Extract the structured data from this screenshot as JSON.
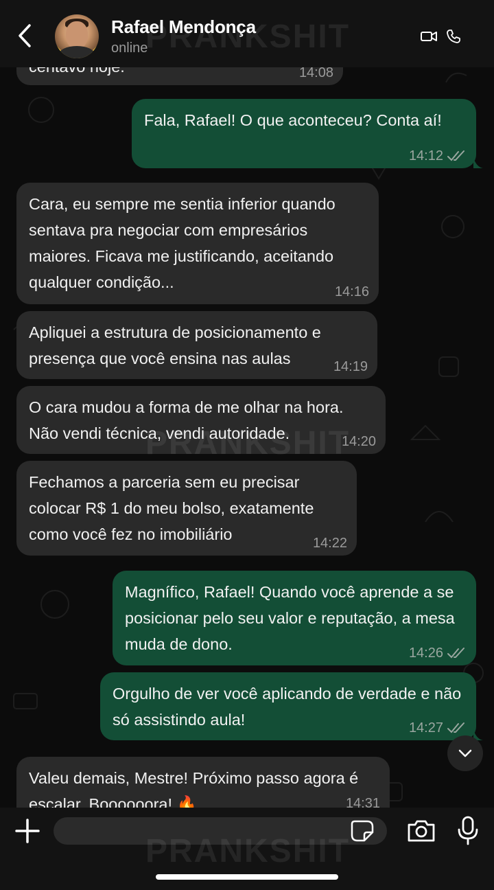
{
  "header": {
    "contact_name": "Rafael Mendonça",
    "status": "online",
    "icons": [
      "back-arrow-icon",
      "video-call-icon",
      "phone-icon"
    ]
  },
  "watermark": "PRANKSHIT",
  "messages": [
    {
      "id": "m0",
      "direction": "incoming",
      "text": "centavo hoje.",
      "time": "14:08"
    },
    {
      "id": "m1",
      "direction": "outgoing",
      "text": "Fala, Rafael! O que aconteceu? Conta aí!",
      "time": "14:12",
      "read": true
    },
    {
      "id": "m2",
      "direction": "incoming",
      "text": "Cara, eu sempre me sentia inferior quando sentava pra negociar com empresários maiores. Ficava me justificando, aceitando qualquer condição...",
      "time": "14:16"
    },
    {
      "id": "m3",
      "direction": "incoming",
      "text": "Apliquei a estrutura de posicionamento e presença que você ensina nas aulas",
      "time": "14:19"
    },
    {
      "id": "m4",
      "direction": "incoming",
      "text": "O cara mudou a forma de me olhar na hora. Não vendi técnica, vendi autoridade.",
      "time": "14:20"
    },
    {
      "id": "m5",
      "direction": "incoming",
      "text": "Fechamos a parceria sem eu precisar colocar R$ 1 do meu bolso, exatamente como você fez no imobiliário",
      "time": "14:22"
    },
    {
      "id": "m6",
      "direction": "outgoing",
      "text": "Magnífico, Rafael! Quando você aprende a se posicionar pelo seu valor e reputação, a mesa muda de dono.",
      "time": "14:26",
      "read": true
    },
    {
      "id": "m7",
      "direction": "outgoing",
      "text": "Orgulho de ver você aplicando de verdade e não só assistindo aula!",
      "time": "14:27",
      "read": true
    },
    {
      "id": "m8",
      "direction": "incoming",
      "text": "Valeu demais, Mestre! Próximo passo agora é escalar. Boooooora! 🔥",
      "time": "14:31"
    }
  ],
  "composer": {
    "placeholder": "",
    "icons": [
      "plus-icon",
      "sticker-icon",
      "camera-icon",
      "microphone-icon"
    ]
  },
  "colors": {
    "incoming_bubble": "#2a2a2a",
    "outgoing_bubble": "#134e36",
    "background": "#0c0c0c",
    "header": "#131313"
  }
}
